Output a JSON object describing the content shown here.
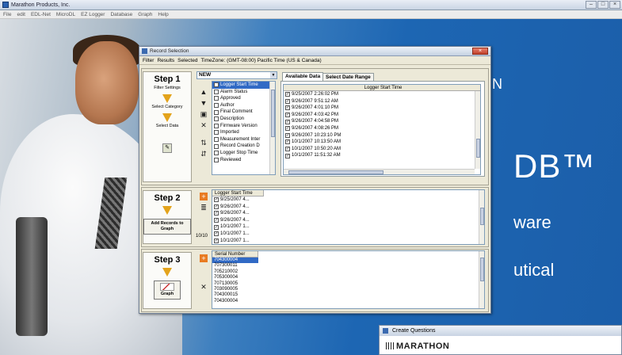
{
  "app": {
    "title": "Marathon Products, Inc.",
    "controls": [
      "–",
      "□",
      "×"
    ],
    "menu": [
      "File",
      "edit",
      "EDL-Net",
      "MicroDL",
      "EZ Logger",
      "Database",
      "Graph",
      "Help"
    ]
  },
  "background": {
    "tm_text": "DB™",
    "ware_text": "ware",
    "utical_text": "utical",
    "n_text": "N"
  },
  "dialog": {
    "title": "Record Selection",
    "close": "×",
    "menu": [
      "Filter",
      "Results",
      "Selected",
      "TimeZone: (GMT-08:00) Pacific Time (US & Canada)"
    ],
    "step1": {
      "title": "Step 1",
      "filter_settings": "Filter Settings",
      "select_category": "Select Category",
      "select_data": "Select Data"
    },
    "filter_select": {
      "value": "NEW"
    },
    "categories": [
      {
        "label": "Logger Start Time",
        "checked": true,
        "selected": true
      },
      {
        "label": "Alarm Status",
        "checked": false
      },
      {
        "label": "Approved",
        "checked": false
      },
      {
        "label": "Author",
        "checked": false
      },
      {
        "label": "Final Comment",
        "checked": false
      },
      {
        "label": "Description",
        "checked": false
      },
      {
        "label": "Firmware Version",
        "checked": false
      },
      {
        "label": "Imported",
        "checked": false
      },
      {
        "label": "Measurement Inter",
        "checked": false
      },
      {
        "label": "Record Creation D",
        "checked": false
      },
      {
        "label": "Logger Stop Time",
        "checked": false
      },
      {
        "label": "Reviewed",
        "checked": false
      }
    ],
    "tabs": {
      "available": "Available Data",
      "range": "Select Date Range"
    },
    "available_header": "Logger Start Time",
    "available_data": [
      "9/25/2007 2:26:02 PM",
      "9/26/2007 9:51:12 AM",
      "9/26/2007 4:01:10 PM",
      "9/26/2007 4:03:42 PM",
      "9/26/2007 4:04:58 PM",
      "9/26/2007 4:08:26 PM",
      "9/26/2007 10:23:10 PM",
      "10/1/2007 10:13:50 AM",
      "10/1/2007 10:50:20 AM",
      "10/1/2007 11:51:32 AM"
    ],
    "step2": {
      "title": "Step 2",
      "button": "Add Records to Graph",
      "count": "10/10",
      "header": "Logger Start Time",
      "records": [
        "9/25/2007 4...",
        "9/26/2007 4...",
        "9/26/2007 4...",
        "9/26/2007 4...",
        "10/1/2007 1...",
        "10/1/2007 1...",
        "10/1/2007 1..."
      ]
    },
    "step3": {
      "title": "Step 3",
      "button": "Graph",
      "header": "Serial Number",
      "serials": [
        "704300004",
        "707300011",
        "705210002",
        "705300004",
        "707130005",
        "703090005",
        "704300015",
        "704300004"
      ]
    }
  },
  "create_questions": {
    "title": "Create Questions",
    "logo": "MARATHON"
  }
}
